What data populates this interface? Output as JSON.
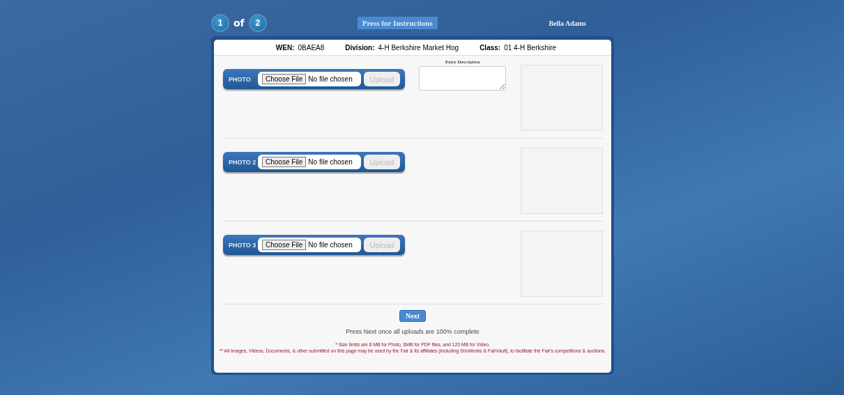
{
  "header": {
    "steps": [
      "1",
      "2"
    ],
    "step_separator": "of",
    "instructions_button": "Press for Instructions",
    "user_name": "Bella Adams"
  },
  "entry_info": [
    {
      "label": "WEN:",
      "value": "0BAEA8"
    },
    {
      "label": "Division:",
      "value": "4-H Berkshire Market Hog"
    },
    {
      "label": "Class:",
      "value": "01 4-H Berkshire"
    }
  ],
  "uploads": [
    {
      "label": "PHOTO",
      "choose_button": "Choose File",
      "file_status": "No file chosen",
      "upload_button": "Upload",
      "upload_disabled": true,
      "description": {
        "label": "Entry Description"
      }
    },
    {
      "label": "PHOTO 2",
      "choose_button": "Choose File",
      "file_status": "No file chosen",
      "upload_button": "Upload",
      "upload_disabled": true
    },
    {
      "label": "PHOTO 3",
      "choose_button": "Choose File",
      "file_status": "No file chosen",
      "upload_button": "Upload",
      "upload_disabled": true
    }
  ],
  "next_button": "Next",
  "next_hint": "Press Next once all uploads are 100% complete",
  "footnotes": [
    "* Size limits are 8 MB for Photo, 6MB for PDF files, and 120 MB for Video.",
    "** All Images, Videos, Documents, & other submitted on this page may be used by the Fair & its affiliates (including ShoWorks & FairVault), to facilitate the Fair's competitions & auctions."
  ]
}
